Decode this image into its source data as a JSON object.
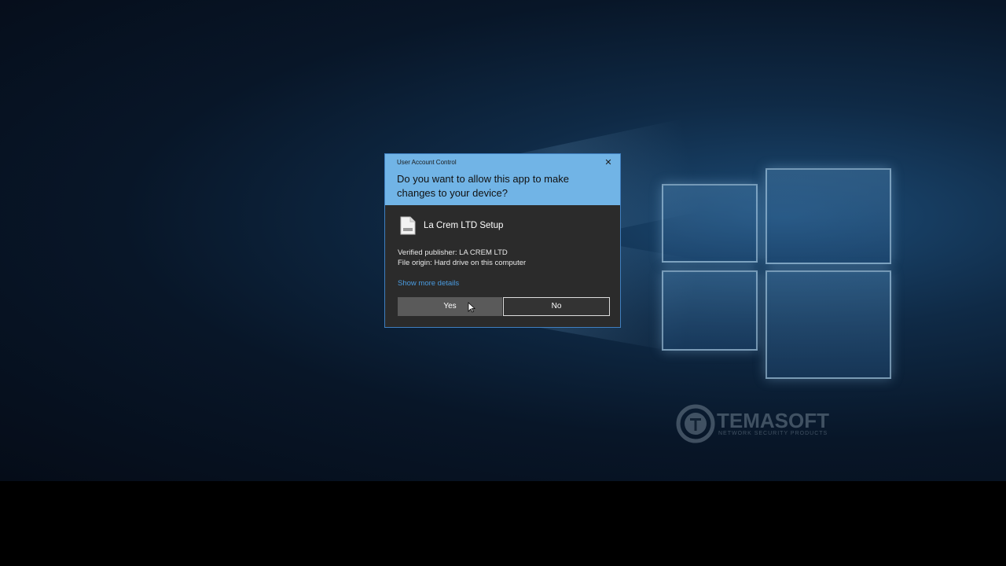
{
  "dialog": {
    "window_title": "User Account Control",
    "question": "Do you want to allow this app to make changes to your device?",
    "app_name": "La Crem LTD Setup",
    "publisher": "Verified publisher: LA CREM LTD",
    "file_origin": "File origin: Hard drive on this computer",
    "details_link": "Show more details",
    "yes_label": "Yes",
    "no_label": "No",
    "close_symbol": "✕"
  },
  "watermark": {
    "brand": "TEMASOFT",
    "tagline": "NETWORK SECURITY PRODUCTS"
  },
  "colors": {
    "header": "#71b4e6",
    "body": "#2b2b2b",
    "link": "#4a9be0"
  }
}
